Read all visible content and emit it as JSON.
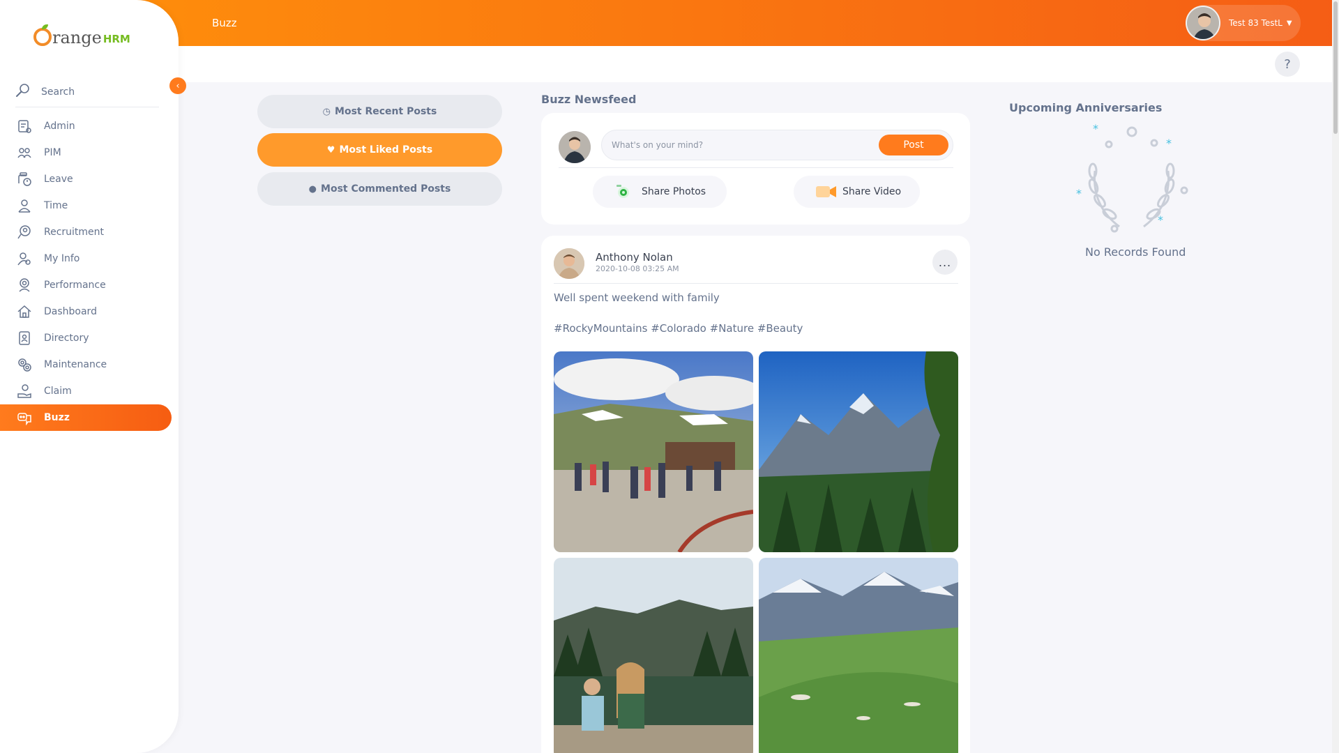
{
  "app": {
    "brand_orange": "range",
    "brand_hrm": "HRM"
  },
  "sidebar": {
    "search_label": "Search",
    "items": [
      {
        "label": "Admin",
        "icon": "admin-icon"
      },
      {
        "label": "PIM",
        "icon": "pim-icon"
      },
      {
        "label": "Leave",
        "icon": "leave-icon"
      },
      {
        "label": "Time",
        "icon": "time-icon"
      },
      {
        "label": "Recruitment",
        "icon": "recruitment-icon"
      },
      {
        "label": "My Info",
        "icon": "my-info-icon"
      },
      {
        "label": "Performance",
        "icon": "performance-icon"
      },
      {
        "label": "Dashboard",
        "icon": "dashboard-icon"
      },
      {
        "label": "Directory",
        "icon": "directory-icon"
      },
      {
        "label": "Maintenance",
        "icon": "maintenance-icon"
      },
      {
        "label": "Claim",
        "icon": "claim-icon"
      },
      {
        "label": "Buzz",
        "icon": "buzz-icon",
        "active": true
      }
    ]
  },
  "header": {
    "breadcrumb": "Buzz",
    "user_name": "Test 83 TestL",
    "help": "?"
  },
  "filters": {
    "most_recent": "Most Recent Posts",
    "most_liked": "Most Liked Posts",
    "most_commented": "Most Commented Posts",
    "active": "most_liked"
  },
  "newsfeed": {
    "title": "Buzz Newsfeed",
    "compose_placeholder": "What's on your mind?",
    "post_button": "Post",
    "share_photos": "Share Photos",
    "share_video": "Share Video"
  },
  "post": {
    "author": "Anthony Nolan",
    "date": "2020-10-08 03:25 AM",
    "text": "Well spent weekend with family",
    "hashtags": "#RockyMountains #Colorado #Nature #Beauty",
    "more": "..."
  },
  "anniversaries": {
    "title": "Upcoming Anniversaries",
    "empty": "No Records Found"
  },
  "colors": {
    "accent": "#ff7b1d",
    "active_filter": "#ff9a2b",
    "text": "#64728c"
  }
}
